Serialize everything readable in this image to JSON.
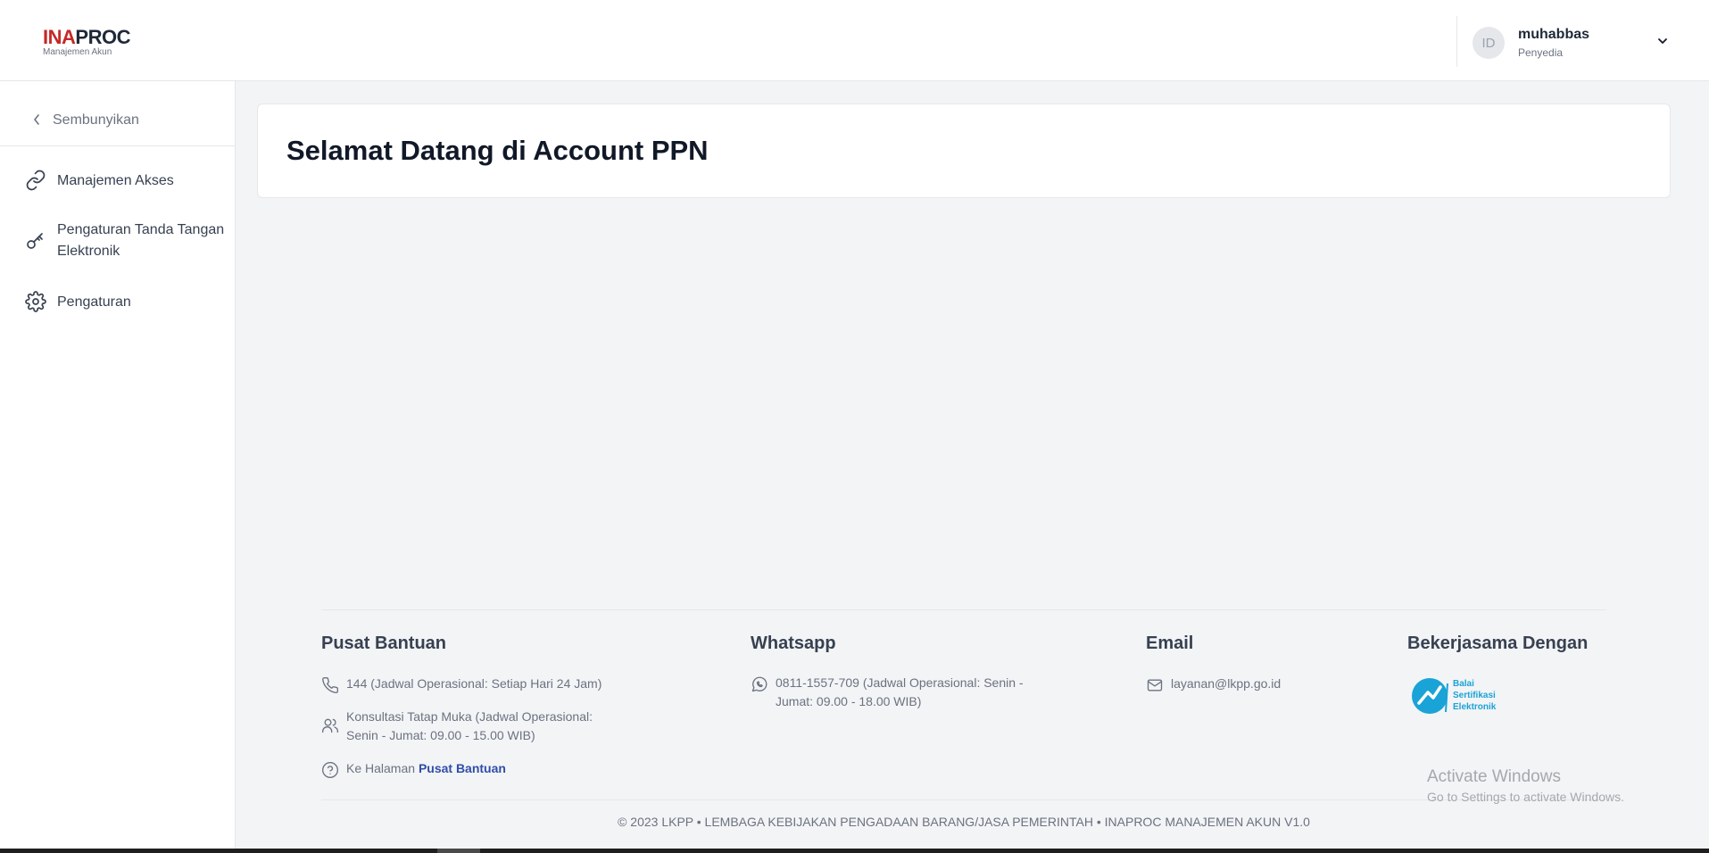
{
  "header": {
    "logo": {
      "brand_ina": "INA",
      "brand_proc": "PROC",
      "subtitle": "Manajemen Akun"
    },
    "user": {
      "avatar_initials": "ID",
      "name": "muhabbas",
      "role": "Penyedia"
    }
  },
  "sidebar": {
    "hide_label": "Sembunyikan",
    "items": [
      {
        "label": "Manajemen Akses",
        "icon": "link-icon"
      },
      {
        "label": "Pengaturan Tanda Tangan Elektronik",
        "icon": "key-icon"
      },
      {
        "label": "Pengaturan",
        "icon": "gear-icon"
      }
    ]
  },
  "main": {
    "welcome_title": "Selamat Datang di Account PPN"
  },
  "footer": {
    "help": {
      "title": "Pusat Bantuan",
      "phone": "144 (Jadwal Operasional: Setiap Hari 24 Jam)",
      "meeting": "Konsultasi Tatap Muka (Jadwal Operasional: Senin - Jumat: 09.00 - 15.00 WIB)",
      "goto_prefix": "Ke Halaman",
      "goto_link": "Pusat Bantuan"
    },
    "whatsapp": {
      "title": "Whatsapp",
      "text": "0811-1557-709 (Jadwal Operasional: Senin - Jumat: 09.00 - 18.00 WIB)"
    },
    "email": {
      "title": "Email",
      "text": "layanan@lkpp.go.id"
    },
    "partner": {
      "title": "Bekerjasama Dengan",
      "logo_text_1": "Balai",
      "logo_text_2": "Sertifikasi",
      "logo_text_3": "Elektronik"
    },
    "copyright": "© 2023 LKPP • LEMBAGA KEBIJAKAN PENGADAAN BARANG/JASA PEMERINTAH • INAPROC MANAJEMEN AKUN V1.0"
  },
  "overlay": {
    "activate_title": "Activate Windows",
    "activate_sub": "Go to Settings to activate Windows."
  },
  "colors": {
    "brand_red": "#c62828",
    "link_blue": "#2f4ea8",
    "partner_blue": "#1aa3d6"
  }
}
